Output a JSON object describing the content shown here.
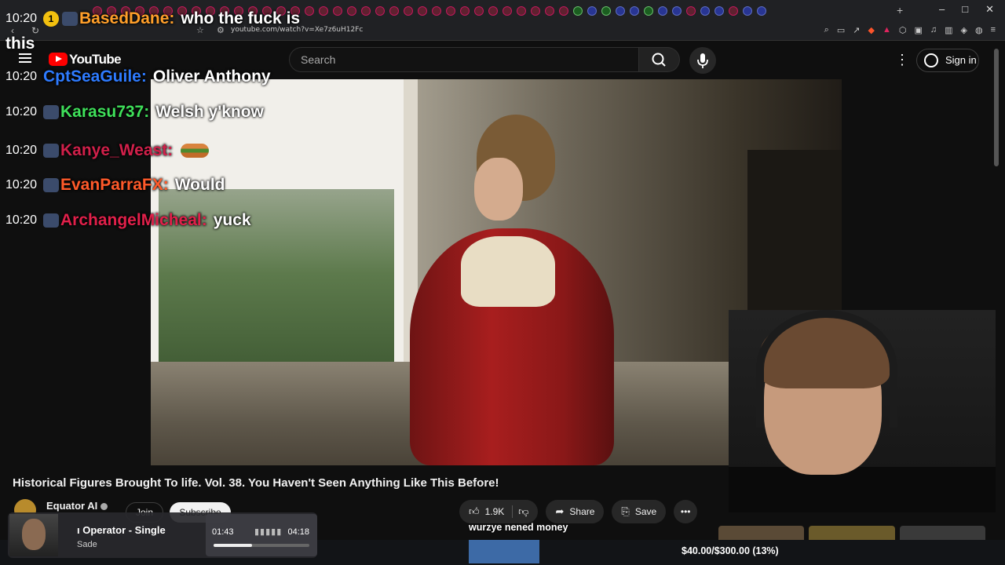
{
  "browser": {
    "url": "youtube.com/watch?v=Xe7z6uH12Fc",
    "new_tab": "+",
    "win_minimize": "–",
    "win_maximize": "□",
    "win_close": "✕",
    "back": "‹",
    "reload": "↻"
  },
  "youtube": {
    "wordmark": "YouTube",
    "search_placeholder": "Search",
    "sign_in": "Sign in",
    "more": "⋮"
  },
  "chat": [
    {
      "time": "10:20",
      "user": "CptSeaGuile:",
      "msg": "Oliver Anthony",
      "color": "#2e7bff"
    },
    {
      "time": "10:20",
      "user": "Karasu737:",
      "msg": "Welsh y'know",
      "color": "#3fe05a"
    },
    {
      "time": "10:20",
      "user": "Kanye_Weast:",
      "msg": "",
      "color": "#d0204a"
    },
    {
      "time": "10:20",
      "user": "EvanParraFX:",
      "msg": "Would",
      "color": "#ff5a2a"
    },
    {
      "time": "10:20",
      "user": "ArchangelMicheal:",
      "msg": "yuck",
      "color": "#e0204a"
    }
  ],
  "chat_top": {
    "time": "10:20",
    "badge": "1",
    "user": "BasedDane:",
    "msg": "who the fuck is",
    "wrap": "this",
    "color": "#ff9f2a"
  },
  "video": {
    "title": "Historical Figures Brought To life. Vol. 38. You Haven't Seen Anything Like This Before!",
    "channel": "Equator AI",
    "join": "Join",
    "subscribe": "Subscribe",
    "likes": "1.9K",
    "share": "Share",
    "save": "Save"
  },
  "music": {
    "title": "ı Operator - Single",
    "artist": "Sade",
    "elapsed": "01:43",
    "total": "04:18",
    "progress": 0.4
  },
  "donation": {
    "note": "wurzye nened money",
    "text": "$40.00/$300.00 (13%)",
    "progress": 0.13
  }
}
